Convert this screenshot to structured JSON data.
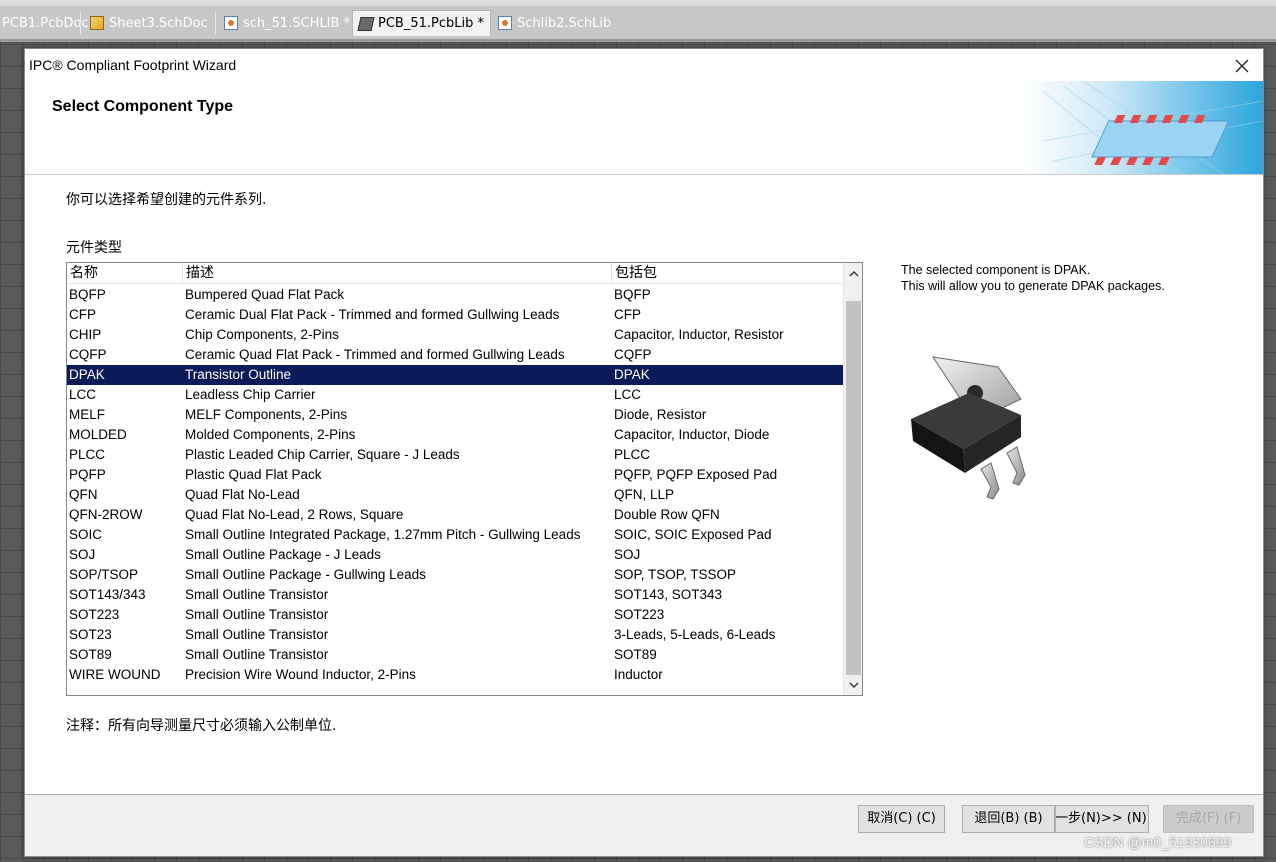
{
  "tabs": [
    {
      "label": "PCB1.PcbDoc",
      "icon": "pcb-doc-icon"
    },
    {
      "label": "Sheet3.SchDoc",
      "icon": "schematic-doc-icon"
    },
    {
      "label": "sch_51.SCHLIB *",
      "icon": "schematic-library-icon"
    },
    {
      "label": "PCB_51.PcbLib *",
      "icon": "pcb-library-icon"
    },
    {
      "label": "Schlib2.SchLib",
      "icon": "schematic-library-icon"
    }
  ],
  "dialog": {
    "title": "IPC® Compliant Footprint Wizard",
    "banner_title": "Select Component Type",
    "intro": "你可以选择希望创建的元件系列.",
    "list_label": "元件类型",
    "note": "注释：所有向导测量尺寸必须输入公制单位.",
    "description_line1": "The selected component is DPAK.",
    "description_line2": "This will allow you to generate DPAK packages."
  },
  "table": {
    "headers": [
      "名称",
      "描述",
      "包括包"
    ],
    "selected_index": 4,
    "rows": [
      [
        "BQFP",
        "Bumpered Quad Flat Pack",
        "BQFP"
      ],
      [
        "CFP",
        "Ceramic Dual Flat Pack - Trimmed and formed Gullwing Leads",
        "CFP"
      ],
      [
        "CHIP",
        "Chip Components, 2-Pins",
        "Capacitor, Inductor, Resistor"
      ],
      [
        "CQFP",
        "Ceramic Quad Flat Pack - Trimmed and formed Gullwing Leads",
        "CQFP"
      ],
      [
        "DPAK",
        "Transistor Outline",
        "DPAK"
      ],
      [
        "LCC",
        "Leadless Chip Carrier",
        "LCC"
      ],
      [
        "MELF",
        "MELF Components, 2-Pins",
        "Diode, Resistor"
      ],
      [
        "MOLDED",
        "Molded Components, 2-Pins",
        "Capacitor, Inductor, Diode"
      ],
      [
        "PLCC",
        "Plastic Leaded Chip Carrier, Square - J Leads",
        "PLCC"
      ],
      [
        "PQFP",
        "Plastic Quad Flat Pack",
        "PQFP, PQFP Exposed Pad"
      ],
      [
        "QFN",
        "Quad Flat No-Lead",
        "QFN, LLP"
      ],
      [
        "QFN-2ROW",
        "Quad Flat No-Lead, 2 Rows, Square",
        "Double Row QFN"
      ],
      [
        "SOIC",
        "Small Outline Integrated Package, 1.27mm Pitch - Gullwing Leads",
        "SOIC, SOIC Exposed Pad"
      ],
      [
        "SOJ",
        "Small Outline Package - J Leads",
        "SOJ"
      ],
      [
        "SOP/TSOP",
        "Small Outline Package - Gullwing Leads",
        "SOP, TSOP, TSSOP"
      ],
      [
        "SOT143/343",
        "Small Outline Transistor",
        "SOT143, SOT343"
      ],
      [
        "SOT223",
        "Small Outline Transistor",
        "SOT223"
      ],
      [
        "SOT23",
        "Small Outline Transistor",
        "3-Leads, 5-Leads, 6-Leads"
      ],
      [
        "SOT89",
        "Small Outline Transistor",
        "SOT89"
      ],
      [
        "WIRE WOUND",
        "Precision Wire Wound Inductor, 2-Pins",
        "Inductor"
      ]
    ]
  },
  "buttons": {
    "cancel": "取消(C) (C)",
    "back": "退回(B) (B)",
    "next": "下一步(N)>> (N)",
    "finish": "完成(F) (F)"
  },
  "watermark": "CSDN @m0_51930699",
  "colors": {
    "selection": "#0b1a58",
    "workspace": "#5a5a5a",
    "footer": "#f0f0f0"
  }
}
